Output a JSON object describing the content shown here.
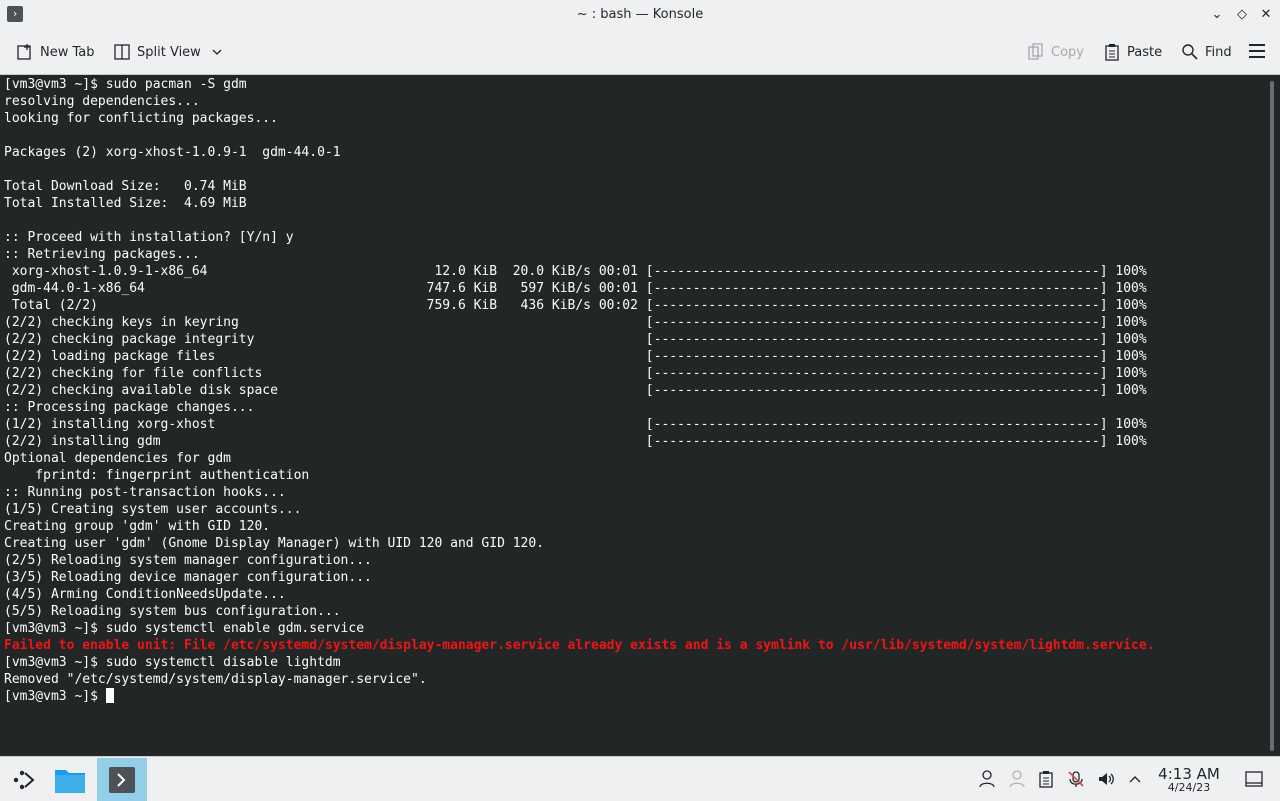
{
  "window": {
    "title": "~ : bash — Konsole",
    "minimize_glyph": "⌄",
    "maximize_glyph": "◇",
    "close_glyph": "✕"
  },
  "toolbar": {
    "new_tab": "New Tab",
    "split_view": "Split View",
    "copy": "Copy",
    "paste": "Paste",
    "find": "Find"
  },
  "terminal": {
    "lines": [
      "[vm3@vm3 ~]$ sudo pacman -S gdm",
      "resolving dependencies...",
      "looking for conflicting packages...",
      "",
      "Packages (2) xorg-xhost-1.0.9-1  gdm-44.0-1",
      "",
      "Total Download Size:   0.74 MiB",
      "Total Installed Size:  4.69 MiB",
      "",
      ":: Proceed with installation? [Y/n] y",
      ":: Retrieving packages...",
      " xorg-xhost-1.0.9-1-x86_64                             12.0 KiB  20.0 KiB/s 00:01 [---------------------------------------------------------] 100%",
      " gdm-44.0-1-x86_64                                    747.6 KiB   597 KiB/s 00:01 [---------------------------------------------------------] 100%",
      " Total (2/2)                                          759.6 KiB   436 KiB/s 00:02 [---------------------------------------------------------] 100%",
      "(2/2) checking keys in keyring                                                    [---------------------------------------------------------] 100%",
      "(2/2) checking package integrity                                                  [---------------------------------------------------------] 100%",
      "(2/2) loading package files                                                       [---------------------------------------------------------] 100%",
      "(2/2) checking for file conflicts                                                 [---------------------------------------------------------] 100%",
      "(2/2) checking available disk space                                               [---------------------------------------------------------] 100%",
      ":: Processing package changes...",
      "(1/2) installing xorg-xhost                                                       [---------------------------------------------------------] 100%",
      "(2/2) installing gdm                                                              [---------------------------------------------------------] 100%",
      "Optional dependencies for gdm",
      "    fprintd: fingerprint authentication",
      ":: Running post-transaction hooks...",
      "(1/5) Creating system user accounts...",
      "Creating group 'gdm' with GID 120.",
      "Creating user 'gdm' (Gnome Display Manager) with UID 120 and GID 120.",
      "(2/5) Reloading system manager configuration...",
      "(3/5) Reloading device manager configuration...",
      "(4/5) Arming ConditionNeedsUpdate...",
      "(5/5) Reloading system bus configuration...",
      "[vm3@vm3 ~]$ sudo systemctl enable gdm.service",
      "Failed to enable unit: File /etc/systemd/system/display-manager.service already exists and is a symlink to /usr/lib/systemd/system/lightdm.service.",
      "[vm3@vm3 ~]$ sudo systemctl disable lightdm",
      "Removed \"/etc/systemd/system/display-manager.service\".",
      "[vm3@vm3 ~]$ "
    ],
    "error_line_index": 33,
    "text_color": "#fcfcfc",
    "error_color": "#ed1515",
    "background": "#232627"
  },
  "taskbar": {
    "launcher_icon": "app-launcher-icon",
    "tasks": [
      "file-manager",
      "konsole"
    ],
    "active_task": "konsole",
    "clock_time": "4:13 AM",
    "clock_date": "4/24/23",
    "active_color": "#93cee9"
  }
}
